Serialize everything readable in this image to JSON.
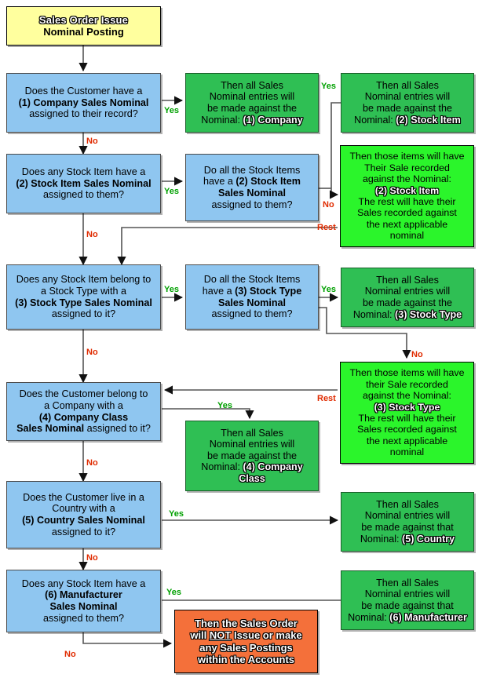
{
  "title": {
    "line1": "Sales Order Issue",
    "line2": "Nominal Posting"
  },
  "colors": {
    "start_fill": "#ffff9e",
    "question_fill": "#8fc6f0",
    "result_fill": "#2fbf54",
    "partial_fill": "#2bf52b",
    "fail_fill": "#f4703a",
    "yes_label": "#00a000",
    "no_label": "#e02b00",
    "rest_label": "#e02b00"
  },
  "labels": {
    "yes": "Yes",
    "no": "No",
    "rest": "Rest"
  },
  "questions": {
    "company": {
      "l1": "Does the Customer have a",
      "l2": "(1) Company Sales Nominal",
      "l3": "assigned to their record?"
    },
    "stock_item_any": {
      "l1": "Does any Stock Item have a",
      "l2": "(2) Stock Item Sales Nominal",
      "l3": "assigned to them?"
    },
    "stock_item_all": {
      "l1": "Do all the Stock Items",
      "l2a": "have a ",
      "l2b": "(2) Stock Item",
      "l3": "Sales Nominal",
      "l4": "assigned to them?"
    },
    "stock_type_any": {
      "l1": "Does any Stock Item belong to",
      "l2": "a Stock Type with a",
      "l3": "(3) Stock Type Sales Nominal",
      "l4": "assigned to it?"
    },
    "stock_type_all": {
      "l1": "Do all the Stock Items",
      "l2a": "have a ",
      "l2b": "(3) Stock Type",
      "l3": "Sales Nominal",
      "l4": "assigned to them?"
    },
    "company_class": {
      "l1": "Does the Customer belong to",
      "l2": "a Company with a",
      "l3": "(4) Company Class",
      "l4a": "Sales Nominal",
      "l4b": " assigned to it?"
    },
    "country": {
      "l1": "Does the Customer live in a",
      "l2": "Country with a",
      "l3": "(5) Country Sales Nominal",
      "l4": "assigned to it?"
    },
    "manufacturer": {
      "l1": "Does any Stock Item have a",
      "l2": "(6) Manufacturer",
      "l3": "Sales Nominal",
      "l4": "assigned to them?"
    }
  },
  "results": {
    "company": {
      "l1": "Then all Sales",
      "l2": "Nominal entries will",
      "l3": "be made against the",
      "l4a": "Nominal:  ",
      "l4b": "(1) Company"
    },
    "stock_item": {
      "l1": "Then all Sales",
      "l2": "Nominal entries will",
      "l3": "be made against the",
      "l4a": "Nominal:  ",
      "l4b": "(2) Stock Item"
    },
    "stock_type": {
      "l1": "Then all Sales",
      "l2": "Nominal entries will",
      "l3": "be made against the",
      "l4a": "Nominal:  ",
      "l4b": "(3) Stock Type"
    },
    "company_class": {
      "l1": "Then all Sales",
      "l2": "Nominal entries will",
      "l3": "be made against the",
      "l4a": "Nominal:  ",
      "l4b": "(4) Company",
      "l5": "Class"
    },
    "country": {
      "l1": "Then all Sales",
      "l2": "Nominal entries will",
      "l3": "be made against that",
      "l4a": "Nominal:  ",
      "l4b": "(5) Country"
    },
    "manufacturer": {
      "l1": "Then all Sales",
      "l2": "Nominal entries will",
      "l3": "be made against that",
      "l4a": "Nominal:  ",
      "l4b": "(6) Manufacturer"
    }
  },
  "partials": {
    "stock_item": {
      "l1": "Then those items will have",
      "l2": "Their Sale recorded",
      "l3": "against the Nominal:",
      "l4": "(2) Stock Item",
      "l5": "The rest will have their",
      "l6": "Sales recorded against",
      "l7": "the next applicable",
      "l8": "nominal"
    },
    "stock_type": {
      "l1": "Then those items will have",
      "l2": "their Sale recorded",
      "l3": "against the Nominal:",
      "l4": "(3) Stock Type",
      "l5": "The rest will have their",
      "l6": "Sales recorded against",
      "l7": "the next applicable",
      "l8": "nominal"
    }
  },
  "fail": {
    "l1": "Then the Sales Order",
    "l2a": "will ",
    "l2b": "NOT",
    "l2c": " Issue or make",
    "l3": "any Sales Postings",
    "l4": "within the Accounts"
  }
}
